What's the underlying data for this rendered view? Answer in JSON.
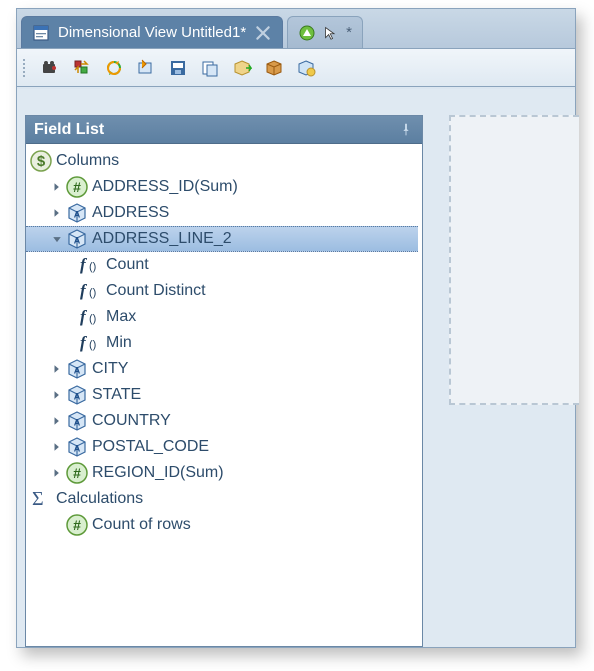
{
  "tabs": [
    {
      "label": "Dimensional View Untitled1*",
      "active": true
    },
    {
      "label": "*",
      "active": false
    }
  ],
  "panel": {
    "title": "Field List"
  },
  "tree": {
    "columns_label": "Columns",
    "calculations_label": "Calculations",
    "items": [
      {
        "label": "ADDRESS_ID(Sum)",
        "type": "hash"
      },
      {
        "label": "ADDRESS",
        "type": "cube"
      },
      {
        "label": "ADDRESS_LINE_2",
        "type": "cube",
        "expanded": true,
        "selected": true
      },
      {
        "label": "CITY",
        "type": "cube"
      },
      {
        "label": "STATE",
        "type": "cube"
      },
      {
        "label": "COUNTRY",
        "type": "cube"
      },
      {
        "label": "POSTAL_CODE",
        "type": "cube"
      },
      {
        "label": "REGION_ID(Sum)",
        "type": "hash"
      }
    ],
    "fn_children": [
      {
        "label": "Count"
      },
      {
        "label": "Count Distinct"
      },
      {
        "label": "Max"
      },
      {
        "label": "Min"
      }
    ],
    "calc_items": [
      {
        "label": "Count of rows",
        "type": "hash"
      }
    ]
  }
}
